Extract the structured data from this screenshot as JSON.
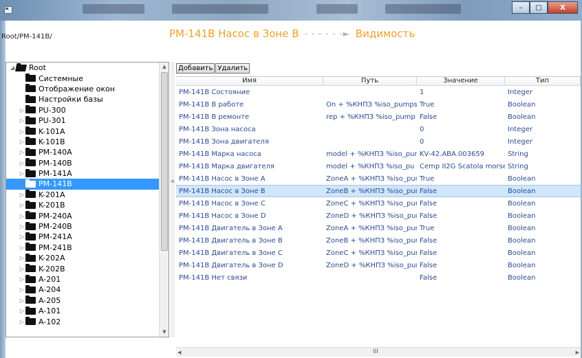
{
  "window": {
    "minimize": "–",
    "maximize": "□",
    "close": "X"
  },
  "path": "Root/PM-141B/",
  "header": {
    "title": "PM-141B Насос в Зоне B",
    "arrow": "- - - - - -►",
    "target": "Видимость"
  },
  "toolbar": {
    "add": "Добавить",
    "delete": "Удалить"
  },
  "tree": [
    {
      "label": "Root",
      "level": 0,
      "expander": "◢",
      "open": true
    },
    {
      "label": "Системные",
      "level": 1,
      "expander": ""
    },
    {
      "label": "Отображение окон",
      "level": 1,
      "expander": ""
    },
    {
      "label": "Настройки базы",
      "level": 1,
      "expander": ""
    },
    {
      "label": "PU-300",
      "level": 1,
      "expander": "▷"
    },
    {
      "label": "PU-301",
      "level": 1,
      "expander": "▷"
    },
    {
      "label": "K-101A",
      "level": 1,
      "expander": "▷"
    },
    {
      "label": "K-101B",
      "level": 1,
      "expander": "▷"
    },
    {
      "label": "PM-140A",
      "level": 1,
      "expander": "▷"
    },
    {
      "label": "PM-140B",
      "level": 1,
      "expander": "▷"
    },
    {
      "label": "PM-141A",
      "level": 1,
      "expander": "▷"
    },
    {
      "label": "PM-141B",
      "level": 1,
      "expander": "▷",
      "selected": true
    },
    {
      "label": "K-201A",
      "level": 1,
      "expander": "▷"
    },
    {
      "label": "K-201B",
      "level": 1,
      "expander": "▷"
    },
    {
      "label": "PM-240A",
      "level": 1,
      "expander": "▷"
    },
    {
      "label": "PM-240B",
      "level": 1,
      "expander": "▷"
    },
    {
      "label": "PM-241A",
      "level": 1,
      "expander": "▷"
    },
    {
      "label": "PM-241B",
      "level": 1,
      "expander": "▷"
    },
    {
      "label": "K-202A",
      "level": 1,
      "expander": "▷"
    },
    {
      "label": "K-202B",
      "level": 1,
      "expander": "▷"
    },
    {
      "label": "A-201",
      "level": 1,
      "expander": "▷"
    },
    {
      "label": "A-204",
      "level": 1,
      "expander": "▷"
    },
    {
      "label": "A-205",
      "level": 1,
      "expander": "▷"
    },
    {
      "label": "A-101",
      "level": 1,
      "expander": "▷"
    },
    {
      "label": "A-102",
      "level": 1,
      "expander": "▷"
    }
  ],
  "grid": {
    "columns": [
      "Имя",
      "Путь",
      "Значение",
      "Тип"
    ],
    "rows": [
      [
        "PM-141B Состояние",
        "",
        "1",
        "Integer"
      ],
      [
        "PM-141B В работе",
        "On + %КНПЗ %iso_pumps",
        "True",
        "Boolean"
      ],
      [
        "PM-141B В ремонте",
        "rep + %КНПЗ %iso_pump",
        "False",
        "Boolean"
      ],
      [
        "PM-141B Зона насоса",
        "",
        "0",
        "Integer"
      ],
      [
        "PM-141B Зона двигателя",
        "",
        "0",
        "Integer"
      ],
      [
        "PM-141B Марка насоса",
        "model + %КНПЗ %iso_pur",
        "KV-42.ABA.003659",
        "String"
      ],
      [
        "PM-141B Марка двигателя",
        "model + %КНПЗ %iso_pu",
        "Cemp II2G Scatola morset",
        "String"
      ],
      [
        "PM-141B Насос в Зоне A",
        "ZoneA + %КНПЗ %iso_pur",
        "True",
        "Boolean"
      ],
      [
        "PM-141B Насос в Зоне B",
        "ZoneB + %КНПЗ %iso_pur",
        "False",
        "Boolean"
      ],
      [
        "PM-141B Насос в Зоне C",
        "ZoneC + %КНПЗ %iso_pur",
        "False",
        "Boolean"
      ],
      [
        "PM-141B Насос в Зоне D",
        "ZoneD + %КНПЗ %iso_pur",
        "False",
        "Boolean"
      ],
      [
        "PM-141B Двигатель в Зоне A",
        "ZoneA + %КНПЗ %iso_pur",
        "True",
        "Boolean"
      ],
      [
        "PM-141B Двигатель в Зоне B",
        "ZoneB + %КНПЗ %iso_pur",
        "False",
        "Boolean"
      ],
      [
        "PM-141B Двигатель в Зоне C",
        "ZoneC + %КНПЗ %iso_pur",
        "False",
        "Boolean"
      ],
      [
        "PM-141B Двигатель в Зоне D",
        "ZoneD + %КНПЗ %iso_pur",
        "False",
        "Boolean"
      ],
      [
        "PM-141B Нет связи",
        "",
        "False",
        "Boolean"
      ]
    ],
    "selected_row": 8
  },
  "scroll": {
    "up": "▲",
    "down": "▼",
    "left": "◀",
    "right": "▶",
    "grip": "III",
    "split_grip": "≡"
  }
}
